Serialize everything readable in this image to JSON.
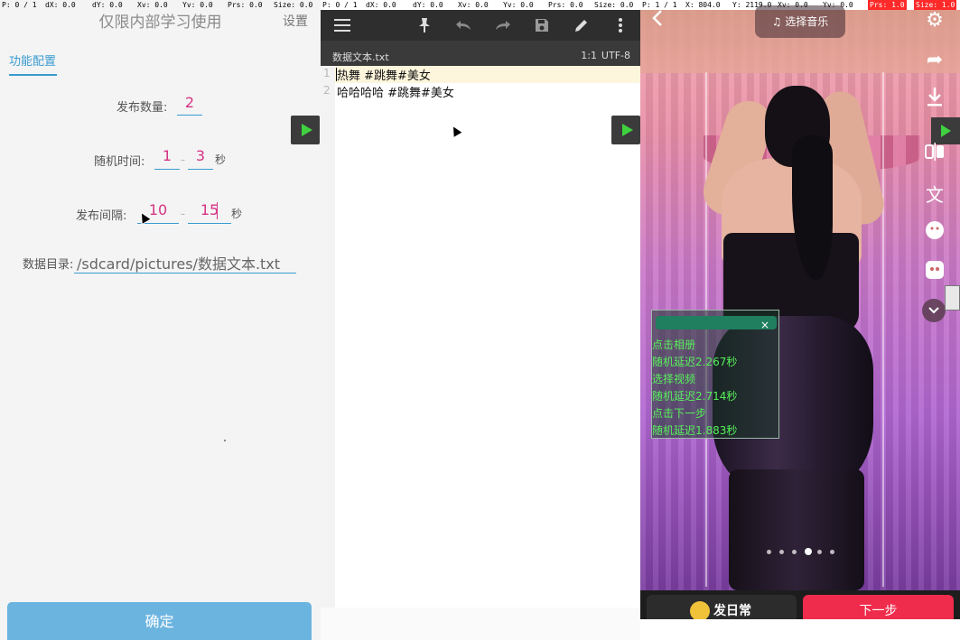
{
  "pointer_bar_1": {
    "p": "P: 0 / 1",
    "dx": "dX: 0.0",
    "dy": "dY: 0.0",
    "xv": "Xv: 0.0",
    "yv": "Yv: 0.0",
    "prs": "Prs: 0.0",
    "size": "Size: 0.0"
  },
  "pointer_bar_2": {
    "p": "P: 0 / 1",
    "dx": "dX: 0.0",
    "dy": "dY: 0.0",
    "xv": "Xv: 0.0",
    "yv": "Yv: 0.0",
    "prs": "Prs: 0.0",
    "size": "Size: 0.0"
  },
  "pointer_bar_3": {
    "p": "P: 1 / 1",
    "x": "X: 804.0",
    "y": "Y: 2119.0",
    "xv": "Xv: 0.0",
    "yv": "Yv: 0.0",
    "prs": "Prs: 1.0",
    "size": "Size: 1.0"
  },
  "config": {
    "title": "仅限内部学习使用",
    "settings_label": "设置",
    "tab_label": "功能配置",
    "publish_count_label": "发布数量:",
    "publish_count_value": "2",
    "random_time_label": "随机时间:",
    "random_time_min": "1",
    "random_time_max": "3",
    "random_time_unit": "秒",
    "publish_interval_label": "发布间隔:",
    "publish_interval_min": "10",
    "publish_interval_max": "15",
    "publish_interval_unit": "秒",
    "range_separator": "–",
    "data_dir_label": "数据目录:",
    "data_dir_value": "/sdcard/pictures/数据文本.txt",
    "confirm_label": "确定"
  },
  "editor": {
    "filename": "数据文本.txt",
    "cursor_pos": "1:1",
    "encoding": "UTF-8",
    "lines": [
      {
        "num": "1",
        "text": "热舞 #跳舞#美女"
      },
      {
        "num": "2",
        "text": "哈哈哈哈 #跳舞#美女"
      }
    ]
  },
  "video": {
    "music_label": "选择音乐",
    "log_lines": [
      "点击相册",
      "随机延迟2.267秒",
      "选择视频",
      "随机延迟2.714秒",
      "点击下一步",
      "随机延迟1.883秒"
    ],
    "daily_label": "发日常",
    "next_label": "下一步",
    "log_close": "×",
    "page_dot_count": 6,
    "page_dot_active_index": 3
  },
  "icons": {
    "menu": "hamburger-icon",
    "pin": "pin-icon",
    "undo": "undo-icon",
    "redo": "redo-icon",
    "save": "save-icon",
    "edit": "pencil-icon",
    "more": "more-vert-icon"
  },
  "colors": {
    "accent_blue": "#3a9bd0",
    "value_pink": "#d63384",
    "log_green": "#56f05a",
    "next_red": "#f02c4c"
  }
}
